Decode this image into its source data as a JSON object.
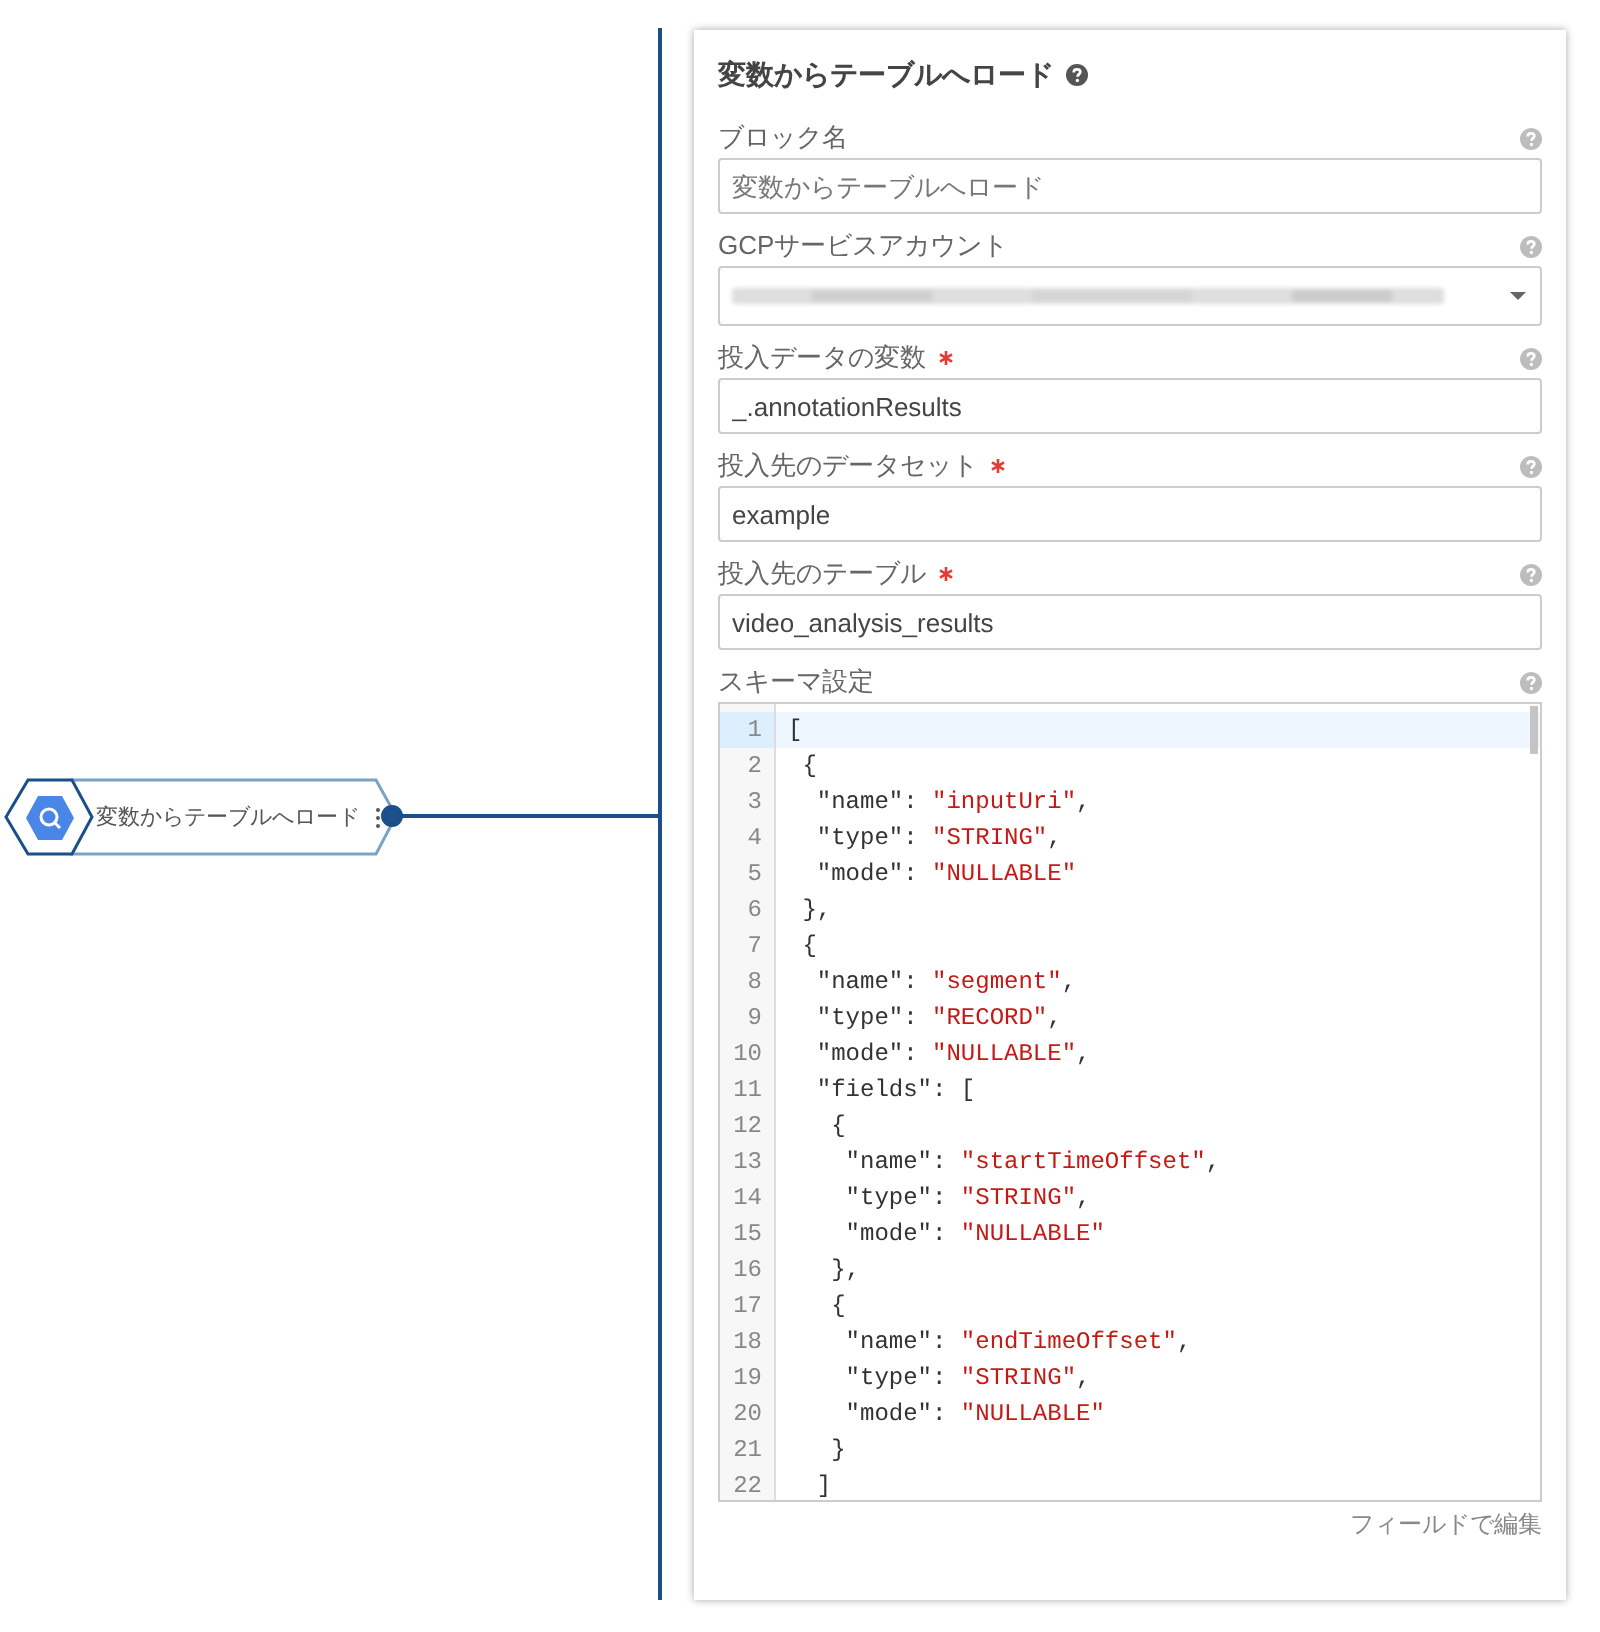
{
  "canvas": {
    "node": {
      "label": "変数からテーブルへロード"
    }
  },
  "panel": {
    "title": "変数からテーブルへロード",
    "fields": [
      {
        "kind": "text",
        "label": "ブロック名",
        "required": false,
        "placeholder": "変数からテーブルへロード"
      },
      {
        "kind": "select",
        "label": "GCPサービスアカウント",
        "required": false,
        "redacted": true
      },
      {
        "kind": "text",
        "label": "投入データの変数",
        "required": true,
        "value": "_.annotationResults"
      },
      {
        "kind": "text",
        "label": "投入先のデータセット",
        "required": true,
        "value": "example"
      },
      {
        "kind": "text",
        "label": "投入先のテーブル",
        "required": true,
        "value": "video_analysis_results"
      }
    ],
    "schema": {
      "label": "スキーマ設定",
      "lines": [
        {
          "number": "1",
          "text": "[",
          "current": true
        },
        {
          "number": "2",
          "text": " {",
          "current": false
        },
        {
          "number": "3",
          "text": "  \"name\": ",
          "string": "\"inputUri\"",
          "after": ",",
          "current": false
        },
        {
          "number": "4",
          "text": "  \"type\": ",
          "string": "\"STRING\"",
          "after": ",",
          "current": false
        },
        {
          "number": "5",
          "text": "  \"mode\": ",
          "string": "\"NULLABLE\"",
          "current": false
        },
        {
          "number": "6",
          "text": " },",
          "current": false
        },
        {
          "number": "7",
          "text": " {",
          "current": false
        },
        {
          "number": "8",
          "text": "  \"name\": ",
          "string": "\"segment\"",
          "after": ",",
          "current": false
        },
        {
          "number": "9",
          "text": "  \"type\": ",
          "string": "\"RECORD\"",
          "after": ",",
          "current": false
        },
        {
          "number": "10",
          "text": "  \"mode\": ",
          "string": "\"NULLABLE\"",
          "after": ",",
          "current": false
        },
        {
          "number": "11",
          "text": "  \"fields\": [",
          "current": false
        },
        {
          "number": "12",
          "text": "   {",
          "current": false
        },
        {
          "number": "13",
          "text": "    \"name\": ",
          "string": "\"startTimeOffset\"",
          "after": ",",
          "current": false
        },
        {
          "number": "14",
          "text": "    \"type\": ",
          "string": "\"STRING\"",
          "after": ",",
          "current": false
        },
        {
          "number": "15",
          "text": "    \"mode\": ",
          "string": "\"NULLABLE\"",
          "current": false
        },
        {
          "number": "16",
          "text": "   },",
          "current": false
        },
        {
          "number": "17",
          "text": "   {",
          "current": false
        },
        {
          "number": "18",
          "text": "    \"name\": ",
          "string": "\"endTimeOffset\"",
          "after": ",",
          "current": false
        },
        {
          "number": "19",
          "text": "    \"type\": ",
          "string": "\"STRING\"",
          "after": ",",
          "current": false
        },
        {
          "number": "20",
          "text": "    \"mode\": ",
          "string": "\"NULLABLE\"",
          "current": false
        },
        {
          "number": "21",
          "text": "   }",
          "current": false
        },
        {
          "number": "22",
          "text": "  ]",
          "current": false
        }
      ],
      "link": "フィールドで編集"
    }
  }
}
